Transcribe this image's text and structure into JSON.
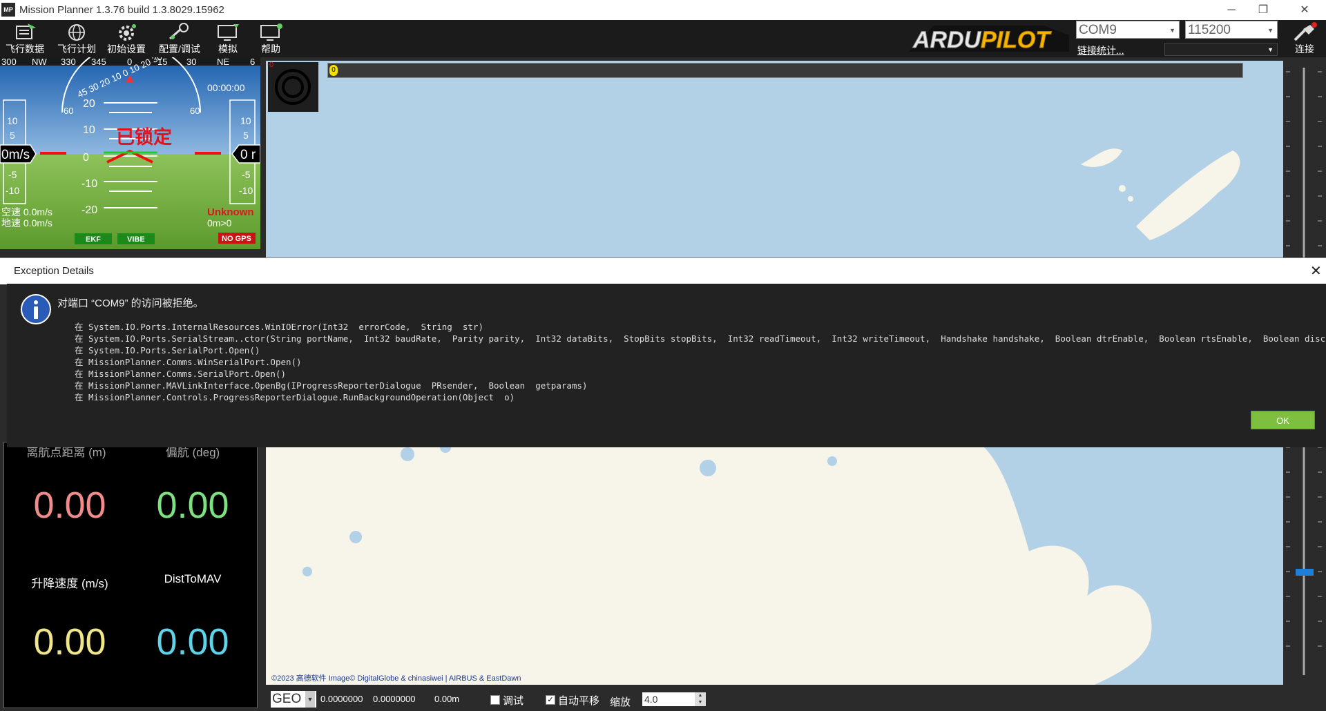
{
  "window": {
    "title": "Mission Planner 1.3.76 build 1.3.8029.15962",
    "icon_text": "MP",
    "minimize": "─",
    "restore": "❐",
    "close": "✕"
  },
  "toolbar": {
    "buttons": [
      {
        "label": "飞行数据",
        "icon": "flight-data-icon"
      },
      {
        "label": "飞行计划",
        "icon": "flight-plan-icon"
      },
      {
        "label": "初始设置",
        "icon": "initial-setup-icon"
      },
      {
        "label": "配置/调试",
        "icon": "config-tuning-icon"
      },
      {
        "label": "模拟",
        "icon": "simulation-icon"
      },
      {
        "label": "帮助",
        "icon": "help-icon"
      }
    ],
    "logo_text": "ARDUPILOT",
    "port": "COM9",
    "baud": "115200",
    "link_stats": "链接统计...",
    "connect_label": "连接"
  },
  "hud": {
    "heading_ticks": [
      "300",
      "NW",
      "330",
      "345",
      "0",
      "15",
      "30",
      "NE",
      "6"
    ],
    "pitch_labels": [
      "20",
      "10",
      "0",
      "-10",
      "-20"
    ],
    "roll_scale_text": "45 30 20 10 0 10 20 30 45",
    "roll_left": "60",
    "roll_right": "60",
    "speed_ticks": [
      "10",
      "5",
      "-5",
      "-10"
    ],
    "speed_value": "0m/s",
    "alt_ticks": [
      "10",
      "5",
      "-5",
      "-10"
    ],
    "alt_value": "0 r",
    "time": "00:00:00",
    "armed_status": "已锁定",
    "airspeed": "空速 0.0m/s",
    "groundspeed": "地速 0.0m/s",
    "mode": "Unknown",
    "wp": "0m>0",
    "ekf": "EKF",
    "vibe": "VIBE",
    "gps": "NO GPS"
  },
  "map": {
    "speed_marker": "0",
    "red_zero": "0",
    "attribution": "©2023 高德软件 Image© DigitalGlobe & chinasiwei | AIRBUS & EastDawn"
  },
  "quick": {
    "top_labels": [
      "离航点距离 (m)",
      "偏航 (deg)"
    ],
    "cells": [
      {
        "label": "",
        "value": "0.00",
        "color": "#f08c8c"
      },
      {
        "label": "",
        "value": "0.00",
        "color": "#7fe07f"
      },
      {
        "label": "升降速度 (m/s)",
        "value": "0.00",
        "color": "#f0e68c"
      },
      {
        "label": "DistToMAV",
        "value": "0.00",
        "color": "#5fd3e8"
      }
    ]
  },
  "bottom": {
    "coord_system": "GEO",
    "lat": "0.0000000",
    "lng": "0.0000000",
    "alt": "0.00m",
    "debug_label": "调试",
    "debug_checked": false,
    "autopan_label": "自动平移",
    "autopan_checked": true,
    "zoom_label": "缩放",
    "zoom_value": "4.0"
  },
  "dialog": {
    "title": "Exception Details",
    "message": "对端口 “COM9” 的访问被拒绝。",
    "trace": [
      "在 System.IO.Ports.InternalResources.WinIOError(Int32  errorCode,  String  str)",
      "在 System.IO.Ports.SerialStream..ctor(String portName,  Int32 baudRate,  Parity parity,  Int32 dataBits,  StopBits stopBits,  Int32 readTimeout,  Int32 writeTimeout,  Handshake handshake,  Boolean dtrEnable,  Boolean rtsEnable,  Boolean discardN",
      "在 System.IO.Ports.SerialPort.Open()",
      "在 MissionPlanner.Comms.WinSerialPort.Open()",
      "在 MissionPlanner.Comms.SerialPort.Open()",
      "在 MissionPlanner.MAVLinkInterface.OpenBg(IProgressReporterDialogue  PRsender,  Boolean  getparams)",
      "在 MissionPlanner.Controls.ProgressReporterDialogue.RunBackgroundOperation(Object  o)"
    ],
    "ok_label": "OK",
    "close": "✕"
  },
  "colors": {
    "accent_green": "#7fbf3f",
    "map_water": "#b2d1e6",
    "map_land": "#f7f4e9",
    "hud_sky": "#2f6fb0",
    "hud_ground": "#6aa53a",
    "armed_red": "#e0141e"
  }
}
